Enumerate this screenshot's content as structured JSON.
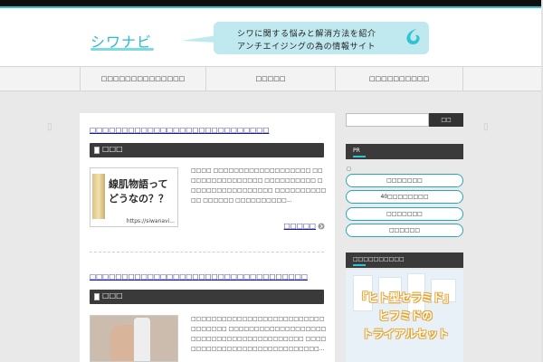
{
  "header": {
    "logo_text": "シワナビ",
    "tagline_line1": "シワに関する悩みと解消方法を紹介",
    "tagline_line2": "アンチエイジングの為の情報サイト"
  },
  "nav": {
    "items": [
      "□□□□□□□□□□□□□□",
      "□□□□□",
      "□□□□□□□□□□"
    ]
  },
  "main": {
    "posts": [
      {
        "title": "□□□□□□□□□□□□□□□□□□□□□□□□□□□□",
        "category": "□□□",
        "thumb_text_line1": "線肌物語って",
        "thumb_text_line2": "どうなの？？",
        "thumb_url": "https://siwanavi...",
        "excerpt": "□□□□ □□□□□□□□□□□□□□□□□□□ □□□□□□□□□□□□□□□□ □□□□□□□□□□ □□□□□□□□□□□□□□□□□ □□□□□□□□□□□□ □□□□□□ □□□□□□□□□□...",
        "readmore": "□□□□□"
      },
      {
        "title": "□□□□□□□□□□□□□□□□□□□□□□□□□□□□□□□□□□",
        "category": "□□□",
        "excerpt": "□□□□□□□□□□□□□□□□□□□□□□□□□□□□□□□□□ □□□□□□□□□□□□□□□□□□□□□□□□□□□□□□□□□□□□□□□□□ □□□□□□□□□□□□□□□□□□□□□□□□□□□□□..."
      }
    ]
  },
  "sidebar": {
    "search_placeholder": "",
    "search_button": "□□",
    "pr_heading": "PR",
    "pr_small": "□",
    "pr_buttons": [
      "□□□□□□□",
      "40□□□□□□□□",
      "□□□□□□□",
      "□□□□□□"
    ],
    "promo_heading": "□□□□□□□□□□",
    "promo_line1": "『ヒト型セラミド』",
    "promo_line2": "ヒフミドの",
    "promo_line3": "トライアルセット"
  },
  "colors": {
    "accent": "#2fc3d4",
    "dark_bar": "#3a3a3a",
    "link": "#1b1f8a"
  }
}
